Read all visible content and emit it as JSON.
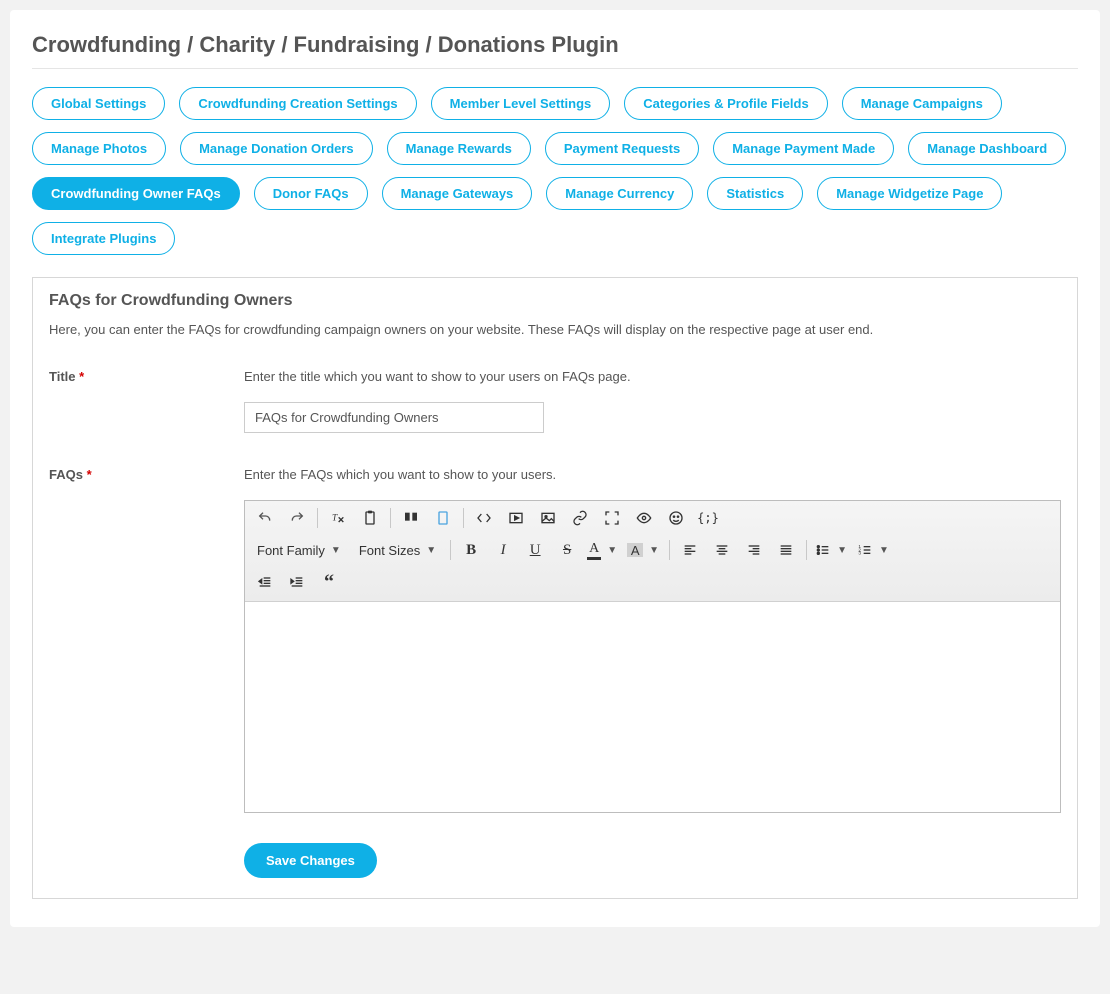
{
  "header": {
    "title": "Crowdfunding / Charity / Fundraising / Donations Plugin"
  },
  "tabs": [
    "Global Settings",
    "Crowdfunding Creation Settings",
    "Member Level Settings",
    "Categories & Profile Fields",
    "Manage Campaigns",
    "Manage Photos",
    "Manage Donation Orders",
    "Manage Rewards",
    "Payment Requests",
    "Manage Payment Made",
    "Manage Dashboard",
    "Crowdfunding Owner FAQs",
    "Donor FAQs",
    "Manage Gateways",
    "Manage Currency",
    "Statistics",
    "Manage Widgetize Page",
    "Integrate Plugins"
  ],
  "active_tab_index": 11,
  "section": {
    "heading": "FAQs for Crowdfunding Owners",
    "description": "Here, you can enter the FAQs for crowdfunding campaign owners on your website. These FAQs will display on the respective page at user end."
  },
  "fields": {
    "title": {
      "label": "Title",
      "required_mark": "*",
      "help": "Enter the title which you want to show to your users on FAQs page.",
      "value": "FAQs for Crowdfunding Owners"
    },
    "faqs": {
      "label": "FAQs",
      "required_mark": "*",
      "help": "Enter the FAQs which you want to show to your users."
    }
  },
  "editor": {
    "font_family_label": "Font Family",
    "font_sizes_label": "Font Sizes",
    "text_color_letter": "A",
    "bg_color_letter": "A"
  },
  "buttons": {
    "save": "Save Changes"
  }
}
